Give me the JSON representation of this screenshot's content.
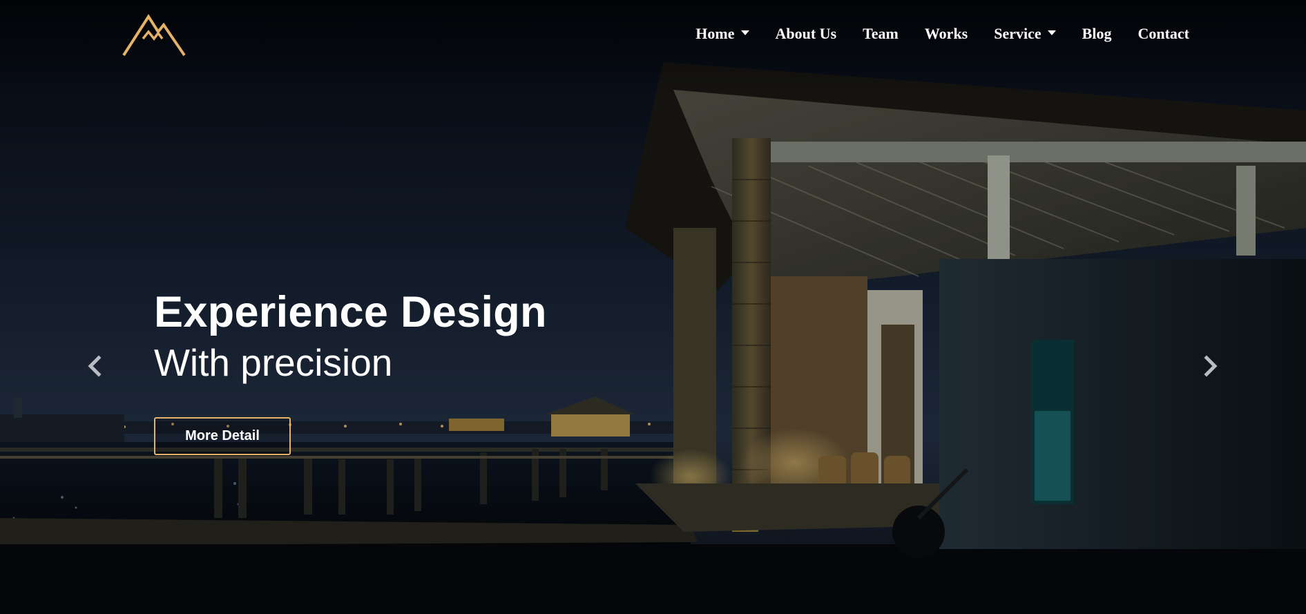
{
  "brand": {
    "logo_icon": "mountain-peak-logo",
    "accent_color": "#e6b266"
  },
  "nav": {
    "items": [
      {
        "label": "Home",
        "has_dropdown": true
      },
      {
        "label": "About Us",
        "has_dropdown": false
      },
      {
        "label": "Team",
        "has_dropdown": false
      },
      {
        "label": "Works",
        "has_dropdown": false
      },
      {
        "label": "Service",
        "has_dropdown": true
      },
      {
        "label": "Blog",
        "has_dropdown": false
      },
      {
        "label": "Contact",
        "has_dropdown": false
      }
    ]
  },
  "hero": {
    "title": "Experience Design",
    "subtitle": "With precision",
    "cta_label": "More Detail",
    "prev_icon": "chevron-left-icon",
    "next_icon": "chevron-right-icon"
  }
}
